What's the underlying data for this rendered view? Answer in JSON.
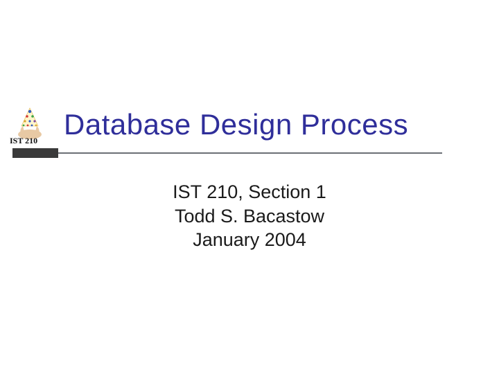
{
  "logo": {
    "label": "IST 210"
  },
  "title": "Database Design Process",
  "subtitle": {
    "line1": "IST 210, Section 1",
    "line2": "Todd S. Bacastow",
    "line3": "January 2004"
  },
  "colors": {
    "title": "#2f2e9a",
    "rule_bar": "#3a3a3a",
    "rule_line": "#6b6f75"
  }
}
